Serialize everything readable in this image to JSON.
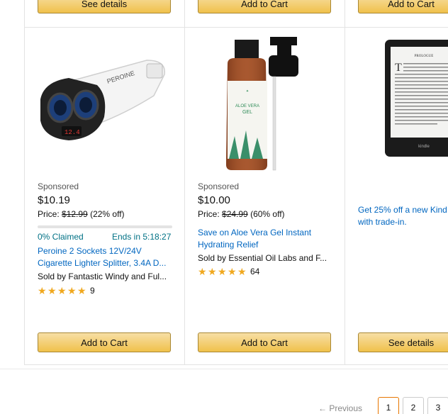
{
  "top_buttons": [
    "See details",
    "Add to Cart",
    "Add to Cart"
  ],
  "products": [
    {
      "sponsored": "Sponsored",
      "price": "$10.19",
      "price_label": "Price:",
      "list_price": "$12.99",
      "discount": "(22% off)",
      "claimed": "0% Claimed",
      "ends": "Ends in 5:18:27",
      "title_line1": "Peroine 2 Sockets 12V/24V",
      "title_line2": "Cigarette Lighter Splitter, 3.4A D...",
      "seller": "Sold by Fantastic Windy and Ful...",
      "rating": 5,
      "reviews": "9",
      "button": "Add to Cart"
    },
    {
      "sponsored": "Sponsored",
      "price": "$10.00",
      "price_label": "Price:",
      "list_price": "$24.99",
      "discount": "(60% off)",
      "title_line1": "Save on Aloe Vera Gel Instant",
      "title_line2": "Hydrating Relief",
      "seller": "Sold by Essential Oil Labs and F...",
      "rating": 5,
      "reviews": "64",
      "button": "Add to Cart"
    },
    {
      "promo_line1": "Get 25% off a new Kind",
      "promo_line2": "with trade-in.",
      "button": "See details"
    }
  ],
  "image_text": {
    "charger_brand": "PEROINE",
    "bottle_line1": "ALOE VERA",
    "bottle_line2": "GEL",
    "kindle_heading": "PROLOGUE",
    "kindle_brand": "kindle"
  },
  "pagination": {
    "previous": "← Previous",
    "pages": [
      "1",
      "2",
      "3"
    ],
    "current": "1"
  },
  "colors": {
    "button_bg": "#f0c14b",
    "link": "#0066c0",
    "star": "#f0a81f"
  }
}
